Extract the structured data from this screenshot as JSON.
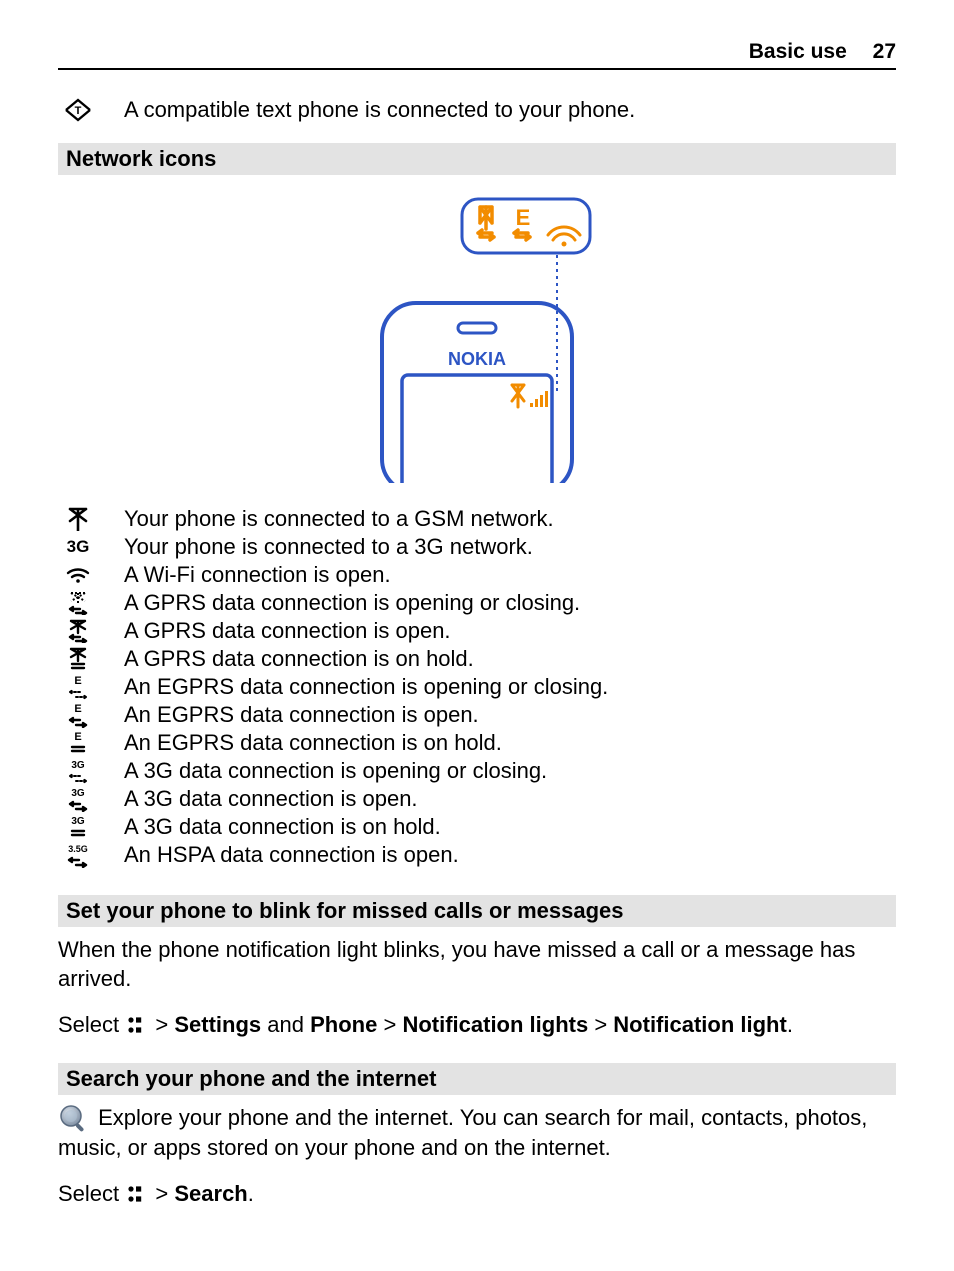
{
  "header": {
    "section": "Basic use",
    "page": "27"
  },
  "intro_row": {
    "text": "A compatible text phone is connected to your phone."
  },
  "section1": {
    "title": "Network icons",
    "illustration_label": "NOKIA",
    "items": [
      {
        "icon": "antenna",
        "text": "Your phone is connected to a GSM network."
      },
      {
        "icon": "3g-text",
        "text": "Your phone is connected to a 3G network."
      },
      {
        "icon": "wifi",
        "text": "A Wi-Fi connection is open."
      },
      {
        "icon": "gprs-dotted",
        "text": "A GPRS data connection is opening or closing."
      },
      {
        "icon": "gprs-open",
        "text": "A GPRS data connection is open."
      },
      {
        "icon": "gprs-hold",
        "text": "A GPRS data connection is on hold."
      },
      {
        "icon": "egprs-dotted",
        "text": "An EGPRS data connection is opening or closing."
      },
      {
        "icon": "egprs-open",
        "text": "An EGPRS data connection is open."
      },
      {
        "icon": "egprs-hold",
        "text": "An EGPRS data connection is on hold."
      },
      {
        "icon": "3g-dotted",
        "text": "A 3G data connection is opening or closing."
      },
      {
        "icon": "3g-open",
        "text": "A 3G data connection is open."
      },
      {
        "icon": "3g-hold",
        "text": "A 3G data connection is on hold."
      },
      {
        "icon": "hspa-open",
        "text": "An HSPA data connection is open."
      }
    ]
  },
  "section2": {
    "title": "Set your phone to blink for missed calls or messages",
    "body": "When the phone notification light blinks, you have missed a call or a message has arrived.",
    "select_prefix": "Select ",
    "path1": "Settings",
    "and": " and ",
    "path2": "Phone",
    "sep": "  >  ",
    "path3": "Notification lights",
    "path4": "Notification light",
    "gt": " > "
  },
  "section3": {
    "title": "Search your phone and the internet",
    "body": "Explore your phone and the internet. You can search for mail, contacts, photos, music, or apps stored on your phone and on the internet.",
    "select_prefix": "Select ",
    "path1": "Search",
    "gt": " > "
  }
}
